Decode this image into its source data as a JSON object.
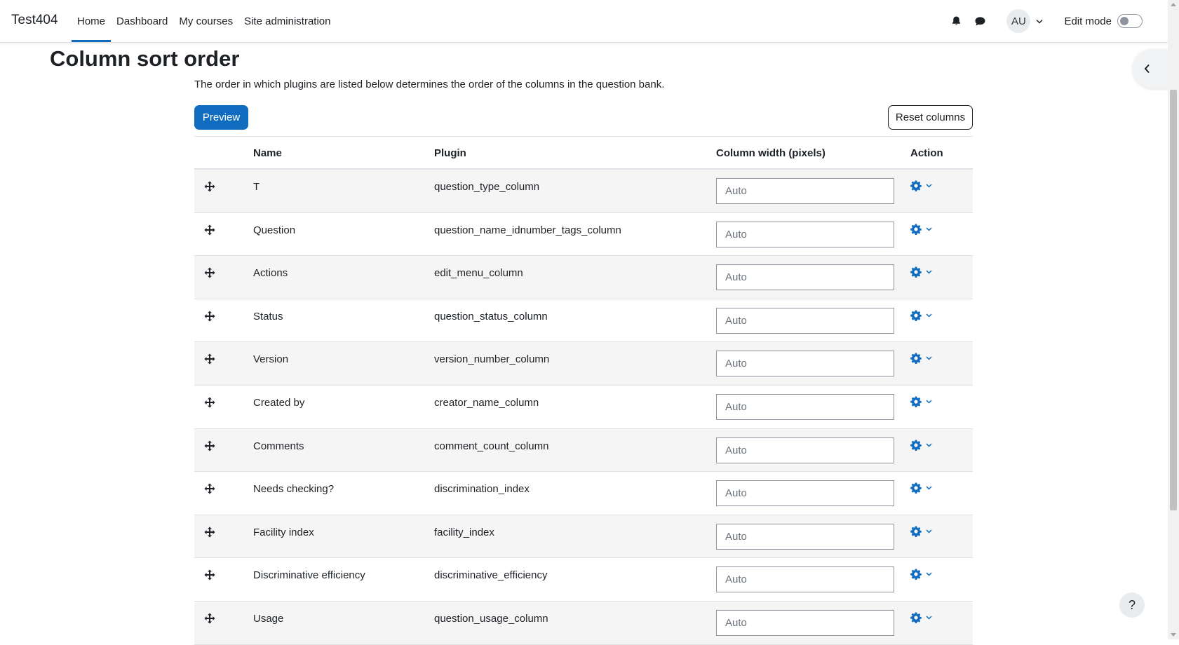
{
  "navbar": {
    "brand": "Test404",
    "links": [
      {
        "label": "Home",
        "active": true
      },
      {
        "label": "Dashboard",
        "active": false
      },
      {
        "label": "My courses",
        "active": false
      },
      {
        "label": "Site administration",
        "active": false
      }
    ],
    "icons": {
      "notifications": "bell-icon",
      "messages": "chat-bubble-icon",
      "user_menu_caret": "chevron-down-icon"
    },
    "avatar_initials": "AU",
    "edit_mode_label": "Edit mode",
    "edit_mode_on": false
  },
  "drawer_toggle_icon": "chevron-left-icon",
  "help_button_label": "?",
  "page": {
    "title": "Column sort order",
    "description": "The order in which plugins are listed below determines the order of the columns in the question bank.",
    "preview_label": "Preview",
    "reset_label": "Reset columns"
  },
  "table": {
    "headers": {
      "name": "Name",
      "plugin": "Plugin",
      "width": "Column width (pixels)",
      "action": "Action"
    },
    "width_placeholder": "Auto",
    "rows": [
      {
        "name": "T",
        "plugin": "question_type_column"
      },
      {
        "name": "Question",
        "plugin": "question_name_idnumber_tags_column"
      },
      {
        "name": "Actions",
        "plugin": "edit_menu_column"
      },
      {
        "name": "Status",
        "plugin": "question_status_column"
      },
      {
        "name": "Version",
        "plugin": "version_number_column"
      },
      {
        "name": "Created by",
        "plugin": "creator_name_column"
      },
      {
        "name": "Comments",
        "plugin": "comment_count_column"
      },
      {
        "name": "Needs checking?",
        "plugin": "discrimination_index"
      },
      {
        "name": "Facility index",
        "plugin": "facility_index"
      },
      {
        "name": "Discriminative efficiency",
        "plugin": "discriminative_efficiency"
      },
      {
        "name": "Usage",
        "plugin": "question_usage_column"
      }
    ]
  },
  "colors": {
    "primary": "#0f6cbf",
    "text": "#1d2125",
    "row_stripe": "#f5f5f5"
  }
}
